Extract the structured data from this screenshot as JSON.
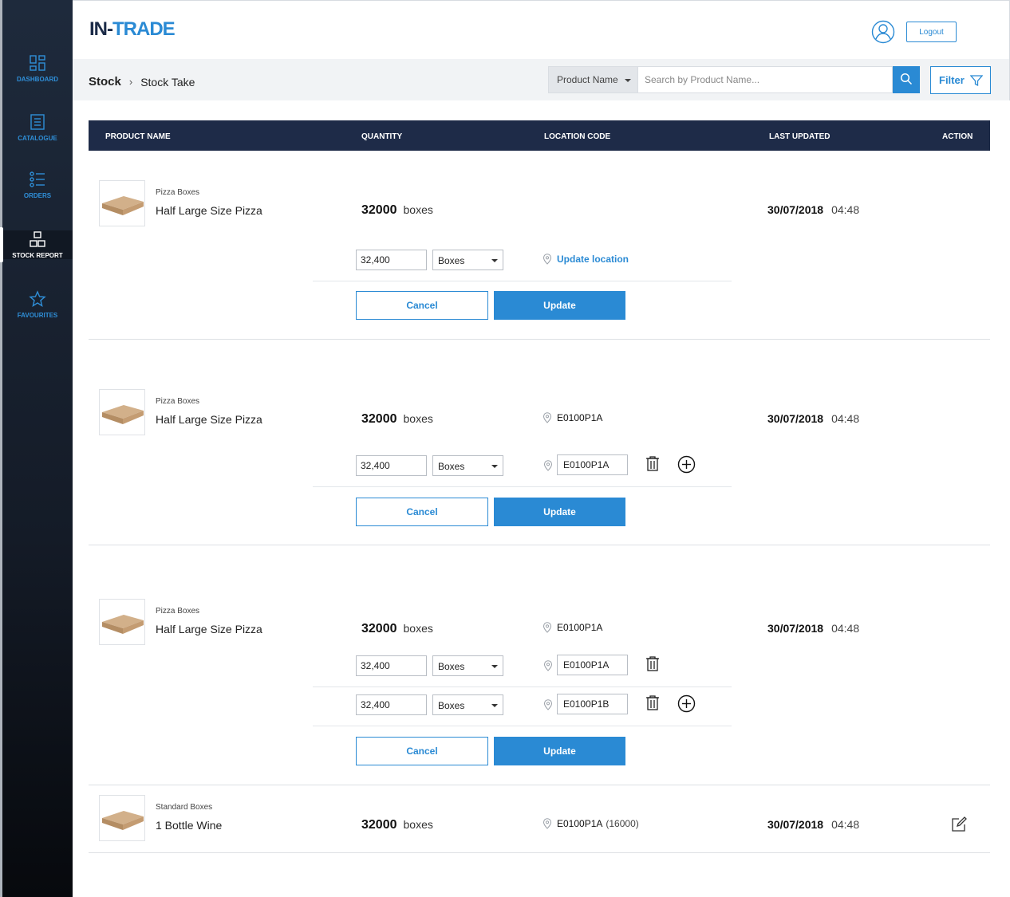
{
  "colors": {
    "accent": "#2a8ad4",
    "header_bg": "#1e2b48",
    "sidebar_bg": "#141b27"
  },
  "sidebar": {
    "items": [
      {
        "label": "DASHBOARD",
        "icon": "dashboard-icon"
      },
      {
        "label": "CATALOGUE",
        "icon": "catalogue-icon"
      },
      {
        "label": "ORDERS",
        "icon": "orders-icon"
      },
      {
        "label": "STOCK REPORT",
        "icon": "stock-report-icon",
        "active": true
      },
      {
        "label": "FAVOURITES",
        "icon": "star-icon"
      }
    ]
  },
  "header": {
    "logo_left": "IN-",
    "logo_right": "TRADE",
    "logout_label": "Logout"
  },
  "breadcrumb": {
    "root": "Stock",
    "current": "Stock Take"
  },
  "search": {
    "type_label": "Product Name",
    "placeholder": "Search by Product Name...",
    "filter_label": "Filter"
  },
  "table": {
    "columns": [
      "PRODUCT NAME",
      "QUANTITY",
      "LOCATION CODE",
      "LAST UPDATED",
      "ACTION"
    ]
  },
  "rows": [
    {
      "category": "Pizza Boxes",
      "name": "Half Large Size Pizza",
      "quantity": "32000",
      "unit": "boxes",
      "location": "",
      "date": "30/07/2018",
      "time": "04:48",
      "update_location_label": "Update location",
      "edit_lines": [
        {
          "qty": "32,400",
          "unit": "Boxes",
          "location": ""
        }
      ]
    },
    {
      "category": "Pizza Boxes",
      "name": "Half Large Size Pizza",
      "quantity": "32000",
      "unit": "boxes",
      "location": "E0100P1A",
      "date": "30/07/2018",
      "time": "04:48",
      "edit_lines": [
        {
          "qty": "32,400",
          "unit": "Boxes",
          "location": "E0100P1A"
        }
      ]
    },
    {
      "category": "Pizza Boxes",
      "name": "Half Large Size Pizza",
      "quantity": "32000",
      "unit": "boxes",
      "location": "E0100P1A",
      "date": "30/07/2018",
      "time": "04:48",
      "edit_lines": [
        {
          "qty": "32,400",
          "unit": "Boxes",
          "location": "E0100P1A"
        },
        {
          "qty": "32,400",
          "unit": "Boxes",
          "location": "E0100P1B"
        }
      ]
    },
    {
      "category": "Standard Boxes",
      "name": "1 Bottle Wine",
      "quantity": "32000",
      "unit": "boxes",
      "location": "E0100P1A",
      "location_count": "(16000)",
      "date": "30/07/2018",
      "time": "04:48"
    }
  ],
  "buttons": {
    "cancel": "Cancel",
    "update": "Update"
  }
}
